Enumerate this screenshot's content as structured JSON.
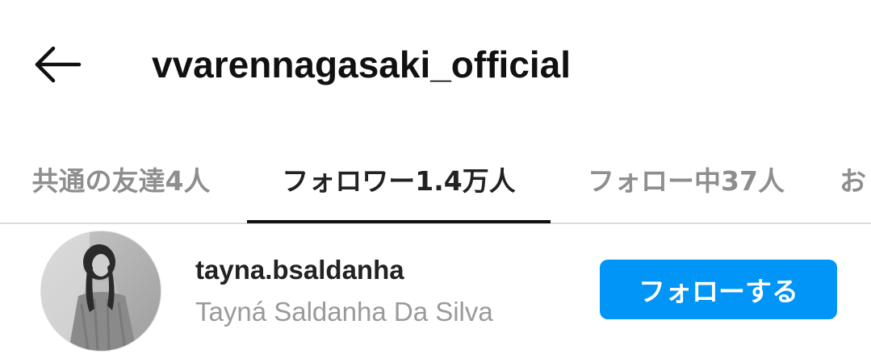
{
  "header": {
    "back_icon": "arrow-left-icon",
    "title": "vvarennagasaki_official"
  },
  "tabs": [
    {
      "label": "共通の友達4人",
      "active": false
    },
    {
      "label": "フォロワー1.4万人",
      "active": true
    },
    {
      "label": "フォロー中37人",
      "active": false
    },
    {
      "label": "お",
      "active": false
    }
  ],
  "user": {
    "avatar_icon": "profile-photo",
    "handle": "tayna.bsaldanha",
    "full_name": "Tayná Saldanha Da Silva",
    "follow_label": "フォローする"
  },
  "colors": {
    "accent": "#0095f6",
    "text_primary": "#111111",
    "text_secondary": "#8e8e8e",
    "divider": "#dbdbdb"
  }
}
